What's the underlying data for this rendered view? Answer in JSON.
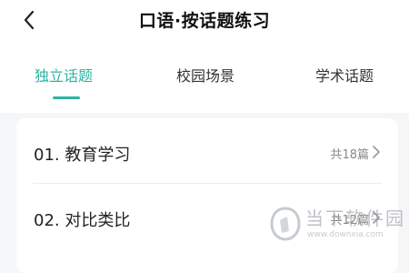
{
  "header": {
    "title": "口语·按话题练习"
  },
  "tabs": [
    {
      "label": "独立话题",
      "active": true
    },
    {
      "label": "校园场景",
      "active": false
    },
    {
      "label": "学术话题",
      "active": false
    }
  ],
  "topics": [
    {
      "title": "01. 教育学习",
      "count": "共18篇"
    },
    {
      "title": "02. 对比类比",
      "count": "共12篇"
    }
  ],
  "watermark": {
    "text": "当下软件园",
    "url": "www.downxia.com"
  },
  "colors": {
    "accent": "#2bb5a3",
    "background": "#f5f6f8",
    "card": "#ffffff"
  }
}
